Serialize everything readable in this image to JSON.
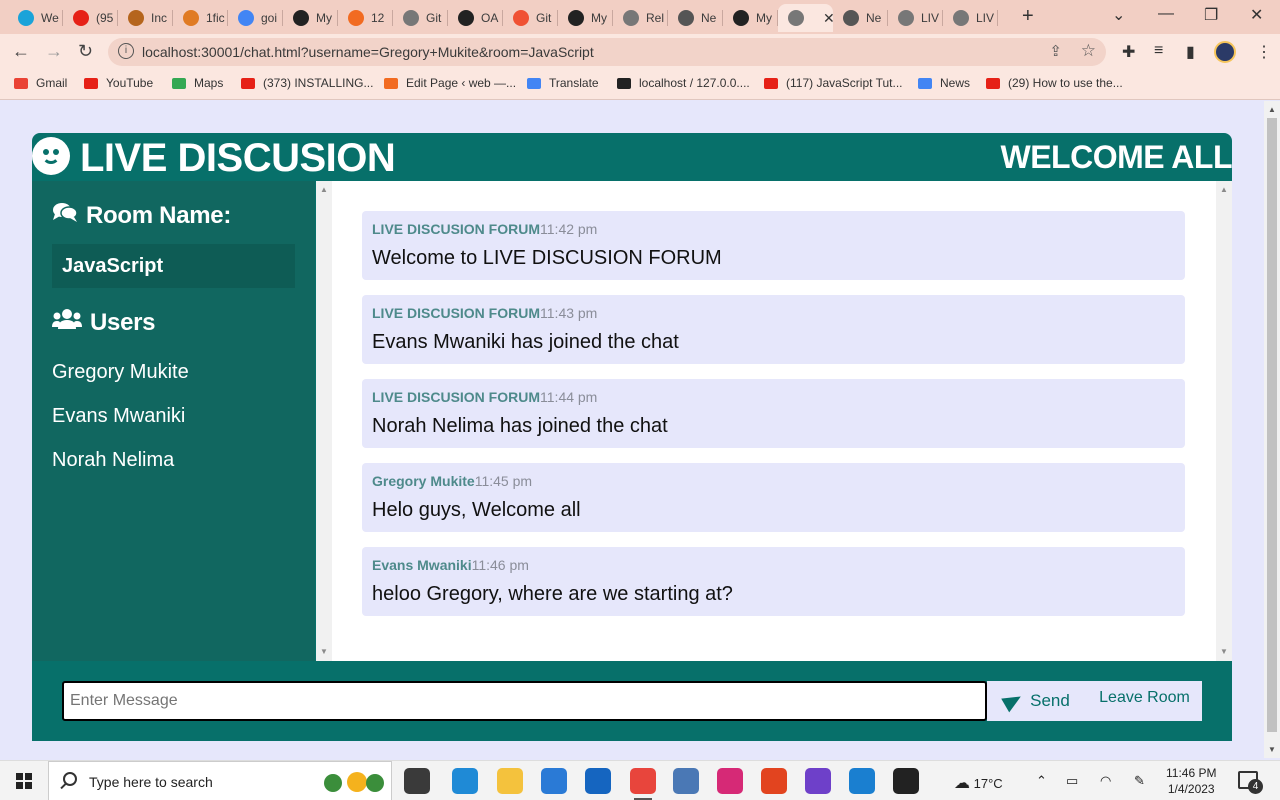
{
  "browser": {
    "tabs": [
      {
        "label": "We",
        "color": "#1aa3d9"
      },
      {
        "label": "(95",
        "color": "#e62117"
      },
      {
        "label": "Inc",
        "color": "#b5651d"
      },
      {
        "label": "1fic",
        "color": "#e07b24"
      },
      {
        "label": "goi",
        "color": "#4285f4"
      },
      {
        "label": "My",
        "color": "#222222"
      },
      {
        "label": "12",
        "color": "#f26b21"
      },
      {
        "label": "Git",
        "color": "#777777"
      },
      {
        "label": "OA",
        "color": "#222222"
      },
      {
        "label": "Git",
        "color": "#f05133"
      },
      {
        "label": "My",
        "color": "#222222"
      },
      {
        "label": "Rel",
        "color": "#777777"
      },
      {
        "label": "Ne",
        "color": "#555555"
      },
      {
        "label": "My",
        "color": "#222222"
      },
      {
        "label": "",
        "color": "#777777",
        "active": true
      },
      {
        "label": "Ne",
        "color": "#555555"
      },
      {
        "label": "LIV",
        "color": "#777777"
      },
      {
        "label": "LIV",
        "color": "#777777"
      }
    ],
    "url": "localhost:30001/chat.html?username=Gregory+Mukite&room=JavaScript",
    "bookmarks": [
      {
        "label": "Gmail",
        "color": "#ea4335"
      },
      {
        "label": "YouTube",
        "color": "#e62117"
      },
      {
        "label": "Maps",
        "color": "#34a853"
      },
      {
        "label": "(373) INSTALLING...",
        "color": "#e62117"
      },
      {
        "label": "Edit Page ‹ web —...",
        "color": "#f26b21"
      },
      {
        "label": "Translate",
        "color": "#4285f4"
      },
      {
        "label": "localhost / 127.0.0....",
        "color": "#222222"
      },
      {
        "label": "(117) JavaScript Tut...",
        "color": "#e62117"
      },
      {
        "label": "News",
        "color": "#4285f4"
      },
      {
        "label": "(29) How to use the...",
        "color": "#e62117"
      }
    ]
  },
  "header": {
    "title": "LIVE DISCUSION",
    "welcome": "WELCOME ALL"
  },
  "sidebar": {
    "room_heading": "Room Name:",
    "room_name": "JavaScript",
    "users_heading": "Users",
    "users": [
      "Gregory Mukite",
      "Evans Mwaniki",
      "Norah Nelima"
    ]
  },
  "messages": [
    {
      "user": "LIVE DISCUSION FORUM",
      "time": "11:42 pm",
      "text": "Welcome to LIVE DISCUSION FORUM"
    },
    {
      "user": "LIVE DISCUSION FORUM",
      "time": "11:43 pm",
      "text": "Evans Mwaniki has joined the chat"
    },
    {
      "user": "LIVE DISCUSION FORUM",
      "time": "11:44 pm",
      "text": "Norah Nelima has joined the chat"
    },
    {
      "user": "Gregory Mukite",
      "time": "11:45 pm",
      "text": "Helo guys, Welcome all"
    },
    {
      "user": "Evans Mwaniki",
      "time": "11:46 pm",
      "text": "heloo Gregory, where are we starting at?"
    }
  ],
  "form": {
    "placeholder": "Enter Message",
    "value": "",
    "send_label": "Send",
    "leave_label": "Leave Room"
  },
  "taskbar": {
    "search_placeholder": "Type here to search",
    "temperature": "17°C",
    "time": "11:46 PM",
    "date": "1/4/2023",
    "notification_count": "4",
    "apps": [
      {
        "icon": "task-view-icon",
        "color": "#3a3a3a"
      },
      {
        "icon": "edge-icon",
        "color": "#1f8ad6"
      },
      {
        "icon": "file-explorer-icon",
        "color": "#f4c23d"
      },
      {
        "icon": "store-icon",
        "color": "#2a7ad6"
      },
      {
        "icon": "mail-icon",
        "color": "#1565c0"
      },
      {
        "icon": "chrome-icon",
        "color": "#e8453c",
        "active": true
      },
      {
        "icon": "control-panel-icon",
        "color": "#4a78b5"
      },
      {
        "icon": "instagram-icon",
        "color": "#d62976"
      },
      {
        "icon": "office-icon",
        "color": "#e2441f"
      },
      {
        "icon": "github-desktop-icon",
        "color": "#6e40c9"
      },
      {
        "icon": "vscode-icon",
        "color": "#1a7fd0"
      },
      {
        "icon": "terminal-icon",
        "color": "#222222"
      }
    ]
  },
  "colors": {
    "primary": "#07706a",
    "sidebar": "#116760",
    "light": "#e6e7fb"
  }
}
